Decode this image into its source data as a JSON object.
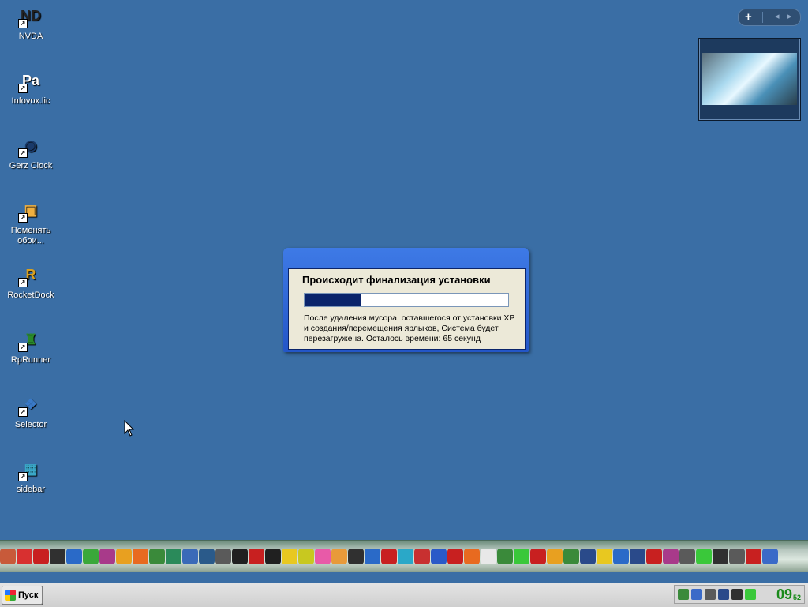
{
  "desktop": {
    "icons": [
      {
        "label": "NVDA",
        "icon": "nvda-icon",
        "glyph": "ND",
        "color": "#222222"
      },
      {
        "label": "Infovox.lic",
        "icon": "license-file-icon",
        "glyph": "Pa",
        "color": "#ffffff"
      },
      {
        "label": "Gerz Clock",
        "icon": "clock-icon",
        "glyph": "◉",
        "color": "#1a3a6a"
      },
      {
        "label": "Поменять обои...",
        "icon": "wallpaper-icon",
        "glyph": "▣",
        "color": "#f0b040"
      },
      {
        "label": "RocketDock",
        "icon": "rocketdock-icon",
        "glyph": "R",
        "color": "#d8a020"
      },
      {
        "label": "RpRunner",
        "icon": "rprunner-icon",
        "glyph": "♜",
        "color": "#2a8a2a"
      },
      {
        "label": "Selector",
        "icon": "selector-icon",
        "glyph": "❖",
        "color": "#3a7ac8"
      },
      {
        "label": "sidebar",
        "icon": "sidebar-icon",
        "glyph": "▦",
        "color": "#3aa8c8"
      }
    ]
  },
  "sidebar": {
    "add_label": "+",
    "prev_label": "◂",
    "next_label": "▸"
  },
  "dialog": {
    "title": "Происходит финализация установки",
    "progress": 0.28,
    "message": "После удаления мусора, оставшегося от установки XP и создания/перемещения ярлыков, Система будет перезагружена. Осталось времени: 65 секунд"
  },
  "dock": {
    "items": [
      {
        "icon": "app-icon",
        "color": "#c85a3a"
      },
      {
        "icon": "app-icon",
        "color": "#d83030"
      },
      {
        "icon": "app-icon",
        "color": "#c82020"
      },
      {
        "icon": "app-icon",
        "color": "#303030"
      },
      {
        "icon": "media-player-icon",
        "color": "#2a6ac8"
      },
      {
        "icon": "app-icon",
        "color": "#3aa83a"
      },
      {
        "icon": "app-icon",
        "color": "#a83a8a"
      },
      {
        "icon": "app-icon",
        "color": "#e8a020"
      },
      {
        "icon": "firefox-icon",
        "color": "#e86a20"
      },
      {
        "icon": "app-icon",
        "color": "#3a8a3a"
      },
      {
        "icon": "app-icon",
        "color": "#2a8a5a"
      },
      {
        "icon": "virtualbox-icon",
        "color": "#3a6ab8"
      },
      {
        "icon": "app-icon",
        "color": "#2a5a8a"
      },
      {
        "icon": "app-icon",
        "color": "#5a5a5a"
      },
      {
        "icon": "reshacker-icon",
        "color": "#202020"
      },
      {
        "icon": "app-icon",
        "color": "#c82020"
      },
      {
        "icon": "app-icon",
        "color": "#202020"
      },
      {
        "icon": "app-icon",
        "color": "#e8c820"
      },
      {
        "icon": "app-icon",
        "color": "#c8c820"
      },
      {
        "icon": "app-icon",
        "color": "#e85aa8"
      },
      {
        "icon": "app-icon",
        "color": "#e89a3a"
      },
      {
        "icon": "app-icon",
        "color": "#303030"
      },
      {
        "icon": "app-icon",
        "color": "#2a6ac8"
      },
      {
        "icon": "app-icon",
        "color": "#c82020"
      },
      {
        "icon": "app-icon",
        "color": "#2aa8c8"
      },
      {
        "icon": "app-icon",
        "color": "#c83030"
      },
      {
        "icon": "app-icon",
        "color": "#2a5ac8"
      },
      {
        "icon": "app-icon",
        "color": "#c82020"
      },
      {
        "icon": "app-icon",
        "color": "#e86a20"
      },
      {
        "icon": "app-icon",
        "color": "#e8e8e8"
      },
      {
        "icon": "app-icon",
        "color": "#3a8a3a"
      },
      {
        "icon": "app-icon",
        "color": "#3ac83a"
      },
      {
        "icon": "opera-icon",
        "color": "#c82020"
      },
      {
        "icon": "app-icon",
        "color": "#e8a020"
      },
      {
        "icon": "app-icon",
        "color": "#3a8a3a"
      },
      {
        "icon": "photoshop-icon",
        "color": "#2a4a8a"
      },
      {
        "icon": "app-icon",
        "color": "#e8c820"
      },
      {
        "icon": "app-icon",
        "color": "#2a6ac8"
      },
      {
        "icon": "app-icon",
        "color": "#2a4a8a"
      },
      {
        "icon": "opera-icon",
        "color": "#c82020"
      },
      {
        "icon": "app-icon",
        "color": "#a83a8a"
      },
      {
        "icon": "app-icon",
        "color": "#5a5a5a"
      },
      {
        "icon": "utorrent-icon",
        "color": "#3ac83a"
      },
      {
        "icon": "app-icon",
        "color": "#303030"
      },
      {
        "icon": "app-icon",
        "color": "#5a5a5a"
      },
      {
        "icon": "ccleaner-icon",
        "color": "#c82020"
      },
      {
        "icon": "app-icon",
        "color": "#3a6ac8"
      }
    ]
  },
  "taskbar": {
    "start_label": "Пуск",
    "clock_hm": "09",
    "clock_s": "52",
    "tray_colors": [
      "#3a8a3a",
      "#3a6ac8",
      "#5a5a5a",
      "#2a4a8a",
      "#303030",
      "#3ac83a"
    ]
  }
}
